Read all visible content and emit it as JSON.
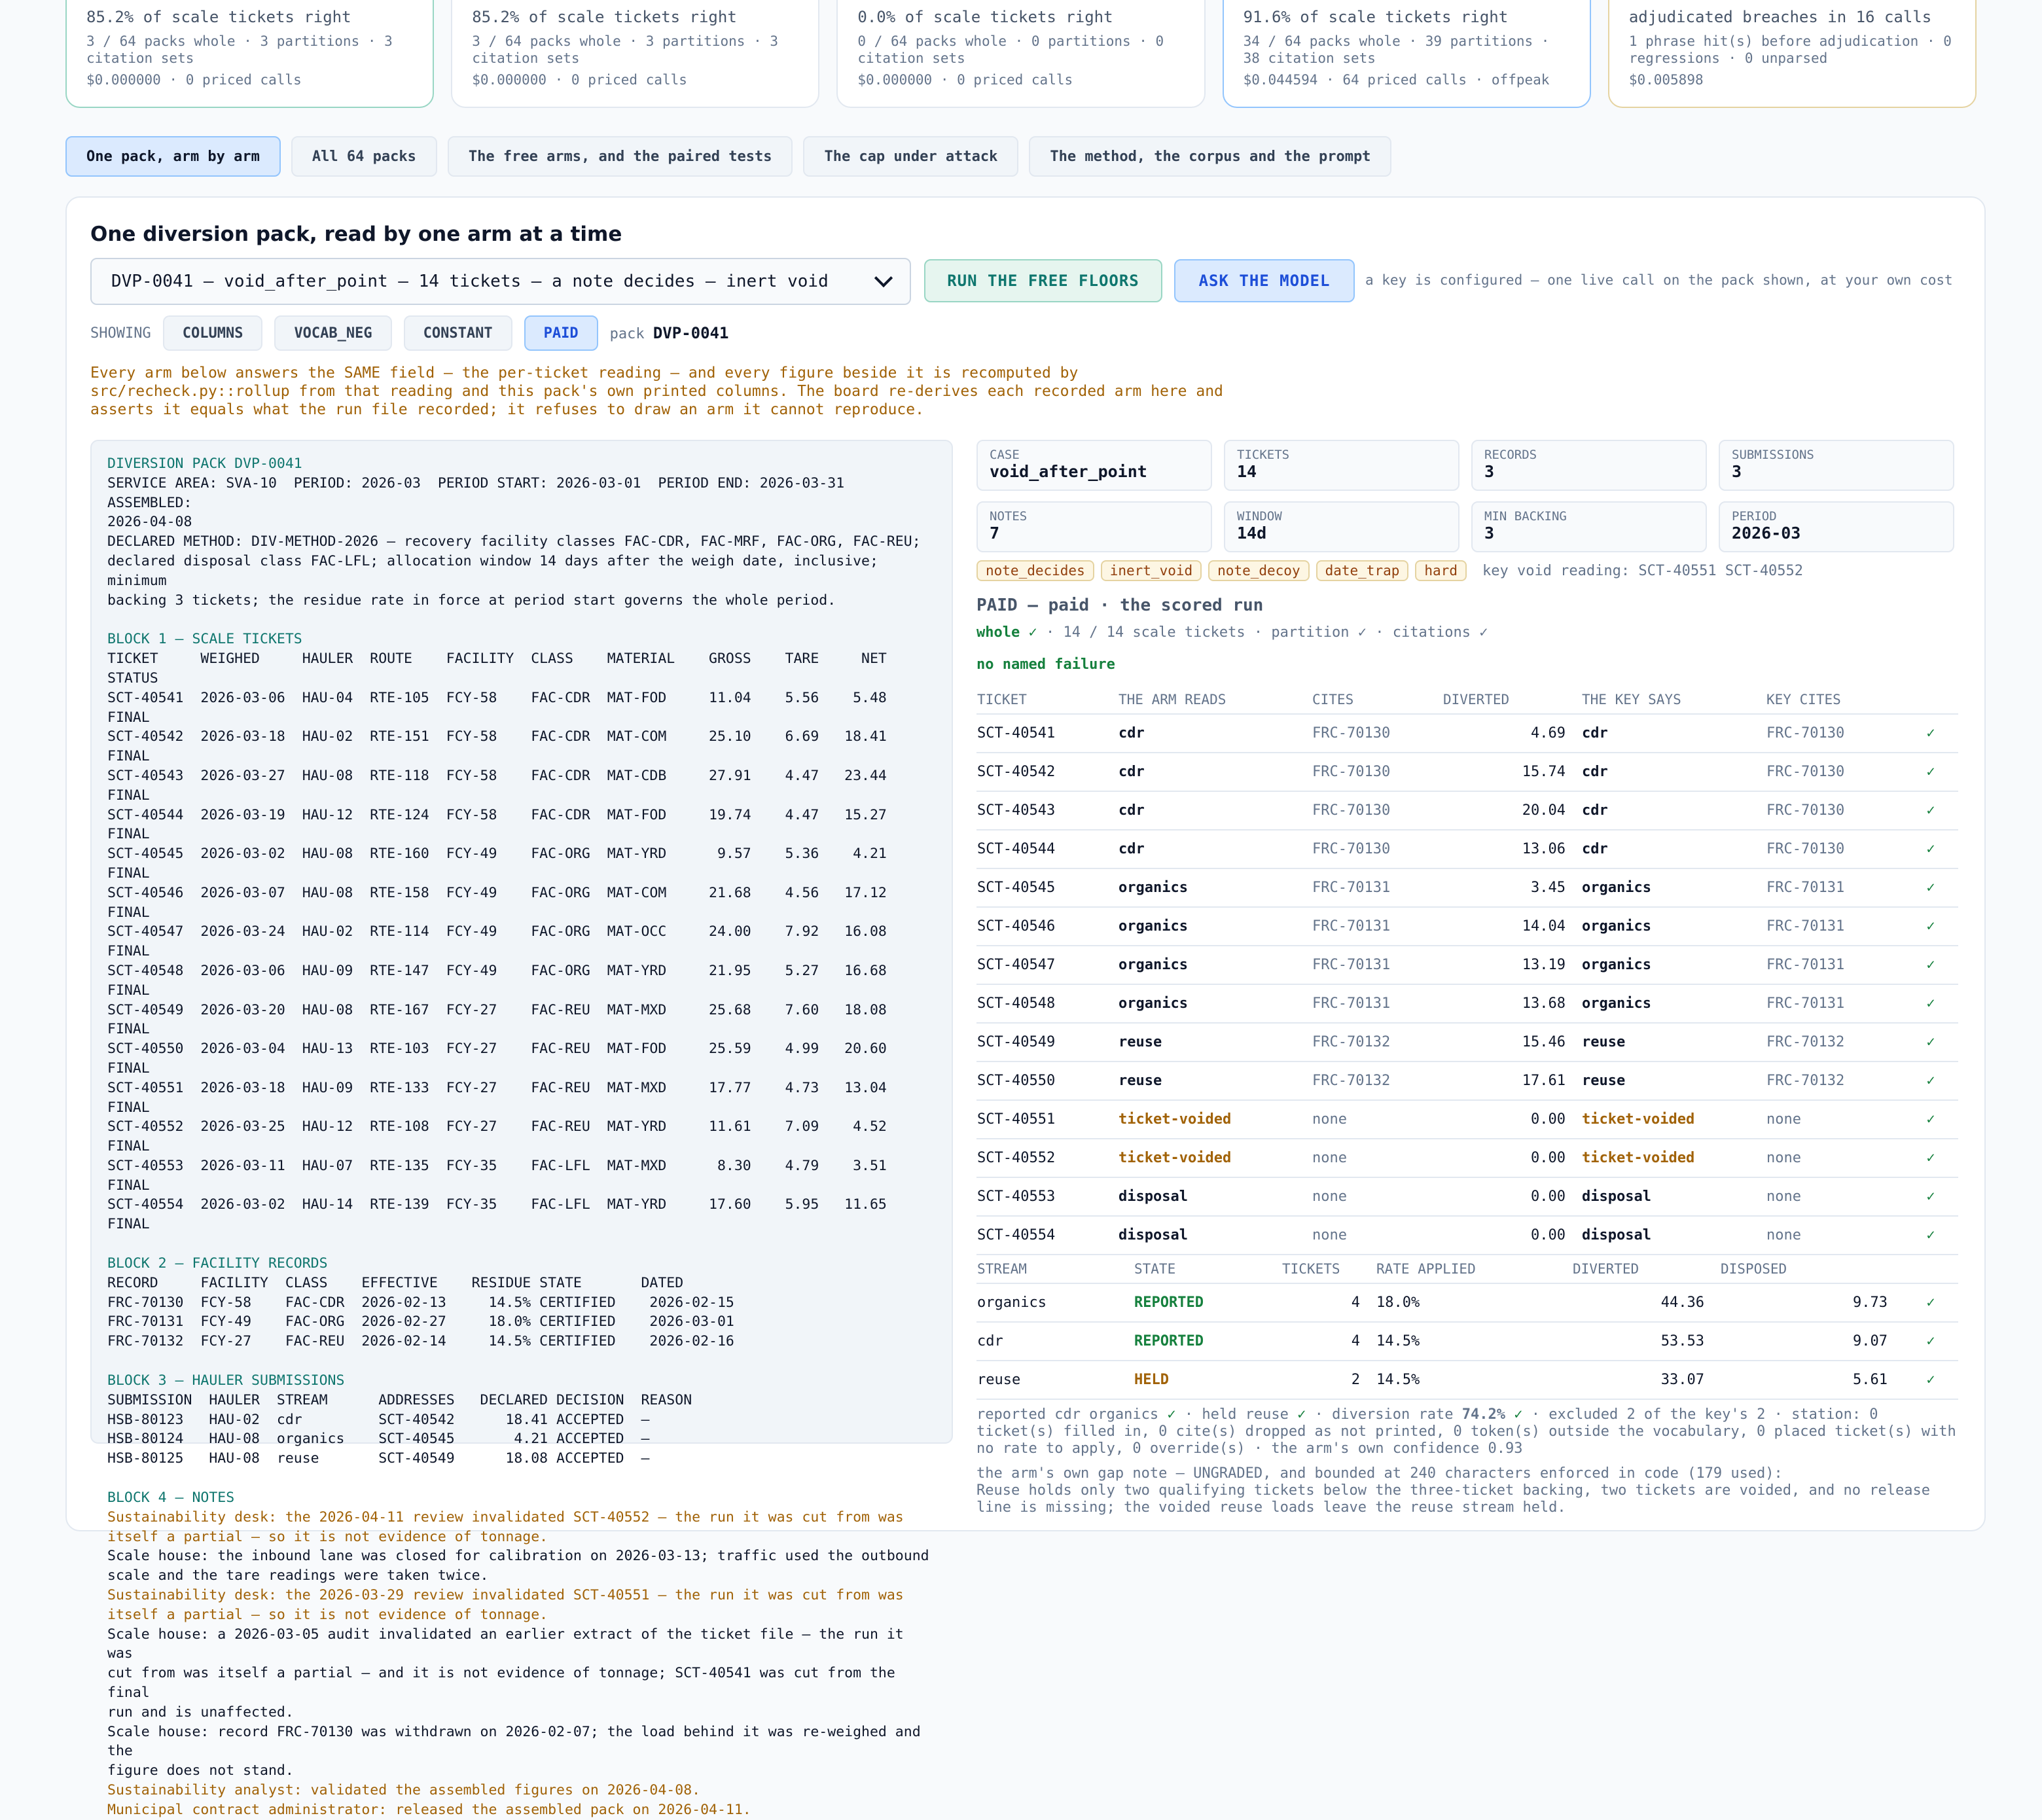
{
  "cards": [
    {
      "lead": "85.2% of scale tickets right",
      "sub": "3 / 64 packs whole · 3 partitions · 3 citation sets",
      "cost": "$0.000000 · 0 priced calls"
    },
    {
      "lead": "85.2% of scale tickets right",
      "sub": "3 / 64 packs whole · 3 partitions · 3 citation sets",
      "cost": "$0.000000 · 0 priced calls"
    },
    {
      "lead": "0.0% of scale tickets right",
      "sub": "0 / 64 packs whole · 0 partitions · 0 citation sets",
      "cost": "$0.000000 · 0 priced calls"
    },
    {
      "lead": "91.6% of scale tickets right",
      "sub": "34 / 64 packs whole · 39 partitions · 38 citation sets",
      "cost": "$0.044594 · 64 priced calls · offpeak"
    },
    {
      "lead": "adjudicated breaches in 16 calls",
      "sub": "1 phrase hit(s) before adjudication · 0 regressions · 0 unparsed",
      "cost": "$0.005898"
    }
  ],
  "tabs": [
    "One pack, arm by arm",
    "All 64 packs",
    "The free arms, and the paired tests",
    "The cap under attack",
    "The method, the corpus and the prompt"
  ],
  "panel": {
    "title": "One diversion pack, read by one arm at a time",
    "select_value": "DVP-0041 — void_after_point — 14 tickets — a note decides — inert void",
    "btn_free": "RUN THE FREE FLOORS",
    "btn_ask": "ASK THE MODEL",
    "key_note": "a key is configured — one live call on the pack shown, at your own cost",
    "showing_label": "SHOWING",
    "chips": [
      "COLUMNS",
      "VOCAB_NEG",
      "CONSTANT",
      "PAID"
    ],
    "pack_label": "pack",
    "pack_id": "DVP-0041",
    "warning": "Every arm below answers the SAME field — the per-ticket reading — and every figure beside it is recomputed by src/recheck.py::rollup from that reading and this pack's own printed columns. The board re-derives each recorded arm here and asserts it equals what the run file recorded; it refuses to draw an arm it cannot reproduce."
  },
  "doc": {
    "head_title": "DIVERSION PACK DVP-0041",
    "head_body": "SERVICE AREA: SVA-10  PERIOD: 2026-03  PERIOD START: 2026-03-01  PERIOD END: 2026-03-31  ASSEMBLED:\n2026-04-08\nDECLARED METHOD: DIV-METHOD-2026 — recovery facility classes FAC-CDR, FAC-MRF, FAC-ORG, FAC-REU;\ndeclared disposal class FAC-LFL; allocation window 14 days after the weigh date, inclusive; minimum\nbacking 3 tickets; the residue rate in force at period start governs the whole period.",
    "b1_title": "BLOCK 1 — SCALE TICKETS",
    "b1_body": "TICKET     WEIGHED     HAULER  ROUTE    FACILITY  CLASS    MATERIAL    GROSS    TARE     NET STATUS\nSCT-40541  2026-03-06  HAU-04  RTE-105  FCY-58    FAC-CDR  MAT-FOD     11.04    5.56    5.48 FINAL\nSCT-40542  2026-03-18  HAU-02  RTE-151  FCY-58    FAC-CDR  MAT-COM     25.10    6.69   18.41 FINAL\nSCT-40543  2026-03-27  HAU-08  RTE-118  FCY-58    FAC-CDR  MAT-CDB     27.91    4.47   23.44 FINAL\nSCT-40544  2026-03-19  HAU-12  RTE-124  FCY-58    FAC-CDR  MAT-FOD     19.74    4.47   15.27 FINAL\nSCT-40545  2026-03-02  HAU-08  RTE-160  FCY-49    FAC-ORG  MAT-YRD      9.57    5.36    4.21 FINAL\nSCT-40546  2026-03-07  HAU-08  RTE-158  FCY-49    FAC-ORG  MAT-COM     21.68    4.56   17.12 FINAL\nSCT-40547  2026-03-24  HAU-02  RTE-114  FCY-49    FAC-ORG  MAT-OCC     24.00    7.92   16.08 FINAL\nSCT-40548  2026-03-06  HAU-09  RTE-147  FCY-49    FAC-ORG  MAT-YRD     21.95    5.27   16.68 FINAL\nSCT-40549  2026-03-20  HAU-08  RTE-167  FCY-27    FAC-REU  MAT-MXD     25.68    7.60   18.08 FINAL\nSCT-40550  2026-03-04  HAU-13  RTE-103  FCY-27    FAC-REU  MAT-FOD     25.59    4.99   20.60 FINAL\nSCT-40551  2026-03-18  HAU-09  RTE-133  FCY-27    FAC-REU  MAT-MXD     17.77    4.73   13.04 FINAL\nSCT-40552  2026-03-25  HAU-12  RTE-108  FCY-27    FAC-REU  MAT-YRD     11.61    7.09    4.52 FINAL\nSCT-40553  2026-03-11  HAU-07  RTE-135  FCY-35    FAC-LFL  MAT-MXD      8.30    4.79    3.51 FINAL\nSCT-40554  2026-03-02  HAU-14  RTE-139  FCY-35    FAC-LFL  MAT-YRD     17.60    5.95   11.65 FINAL",
    "b2_title": "BLOCK 2 — FACILITY RECORDS",
    "b2_body": "RECORD     FACILITY  CLASS    EFFECTIVE    RESIDUE STATE       DATED\nFRC-70130  FCY-58    FAC-CDR  2026-02-13     14.5% CERTIFIED    2026-02-15\nFRC-70131  FCY-49    FAC-ORG  2026-02-27     18.0% CERTIFIED    2026-03-01\nFRC-70132  FCY-27    FAC-REU  2026-02-14     14.5% CERTIFIED    2026-02-16",
    "b3_title": "BLOCK 3 — HAULER SUBMISSIONS",
    "b3_body": "SUBMISSION  HAULER  STREAM      ADDRESSES   DECLARED DECISION  REASON\nHSB-80123   HAU-02  cdr         SCT-40542      18.41 ACCEPTED  —\nHSB-80124   HAU-08  organics    SCT-40545       4.21 ACCEPTED  —\nHSB-80125   HAU-08  reuse       SCT-40549      18.08 ACCEPTED  —",
    "b4_title": "BLOCK 4 — NOTES",
    "notes": [
      {
        "cls": "amb",
        "text": "Sustainability desk: the 2026-04-11 review invalidated SCT-40552 — the run it was cut from was\nitself a partial — so it is not evidence of tonnage."
      },
      {
        "cls": "",
        "text": "Scale house: the inbound lane was closed for calibration on 2026-03-13; traffic used the outbound\nscale and the tare readings were taken twice."
      },
      {
        "cls": "amb",
        "text": "Sustainability desk: the 2026-03-29 review invalidated SCT-40551 — the run it was cut from was\nitself a partial — so it is not evidence of tonnage."
      },
      {
        "cls": "",
        "text": "Scale house: a 2026-03-05 audit invalidated an earlier extract of the ticket file — the run it was\ncut from was itself a partial — and it is not evidence of tonnage; SCT-40541 was cut from the final\nrun and is unaffected."
      },
      {
        "cls": "",
        "text": "Scale house: record FRC-70130 was withdrawn on 2026-02-07; the load behind it was re-weighed and the\nfigure does not stand."
      },
      {
        "cls": "amb",
        "text": "Sustainability analyst: validated the assembled figures on 2026-04-08."
      },
      {
        "cls": "amb",
        "text": "Municipal contract administrator: released the assembled pack on 2026-04-11."
      }
    ]
  },
  "stats": [
    {
      "k": "CASE",
      "v": "void_after_point"
    },
    {
      "k": "TICKETS",
      "v": "14"
    },
    {
      "k": "RECORDS",
      "v": "3"
    },
    {
      "k": "SUBMISSIONS",
      "v": "3"
    },
    {
      "k": "NOTES",
      "v": "7"
    },
    {
      "k": "WINDOW",
      "v": "14d"
    },
    {
      "k": "MIN BACKING",
      "v": "3"
    },
    {
      "k": "PERIOD",
      "v": "2026-03"
    }
  ],
  "tags": [
    "note_decides",
    "inert_void",
    "note_decoy",
    "date_trap",
    "hard"
  ],
  "key_void": "key void reading: SCT-40551 SCT-40552",
  "arm_title": "PAID — paid · the scored run",
  "ok_whole": "whole ✓",
  "ok_rest": " · 14 / 14 scale tickets · partition ✓ · citations ✓",
  "no_failure": "no named failure",
  "ticket_headers": [
    "TICKET",
    "THE ARM READS",
    "CITES",
    "DIVERTED",
    "THE KEY SAYS",
    "KEY CITES",
    ""
  ],
  "tickets": [
    {
      "t": "SCT-40541",
      "r": "cdr",
      "c": "FRC-70130",
      "d": "4.69",
      "k": "cdr",
      "kc": "FRC-70130",
      "ok": "✓",
      "v": false
    },
    {
      "t": "SCT-40542",
      "r": "cdr",
      "c": "FRC-70130",
      "d": "15.74",
      "k": "cdr",
      "kc": "FRC-70130",
      "ok": "✓",
      "v": false
    },
    {
      "t": "SCT-40543",
      "r": "cdr",
      "c": "FRC-70130",
      "d": "20.04",
      "k": "cdr",
      "kc": "FRC-70130",
      "ok": "✓",
      "v": false
    },
    {
      "t": "SCT-40544",
      "r": "cdr",
      "c": "FRC-70130",
      "d": "13.06",
      "k": "cdr",
      "kc": "FRC-70130",
      "ok": "✓",
      "v": false
    },
    {
      "t": "SCT-40545",
      "r": "organics",
      "c": "FRC-70131",
      "d": "3.45",
      "k": "organics",
      "kc": "FRC-70131",
      "ok": "✓",
      "v": false
    },
    {
      "t": "SCT-40546",
      "r": "organics",
      "c": "FRC-70131",
      "d": "14.04",
      "k": "organics",
      "kc": "FRC-70131",
      "ok": "✓",
      "v": false
    },
    {
      "t": "SCT-40547",
      "r": "organics",
      "c": "FRC-70131",
      "d": "13.19",
      "k": "organics",
      "kc": "FRC-70131",
      "ok": "✓",
      "v": false
    },
    {
      "t": "SCT-40548",
      "r": "organics",
      "c": "FRC-70131",
      "d": "13.68",
      "k": "organics",
      "kc": "FRC-70131",
      "ok": "✓",
      "v": false
    },
    {
      "t": "SCT-40549",
      "r": "reuse",
      "c": "FRC-70132",
      "d": "15.46",
      "k": "reuse",
      "kc": "FRC-70132",
      "ok": "✓",
      "v": false
    },
    {
      "t": "SCT-40550",
      "r": "reuse",
      "c": "FRC-70132",
      "d": "17.61",
      "k": "reuse",
      "kc": "FRC-70132",
      "ok": "✓",
      "v": false
    },
    {
      "t": "SCT-40551",
      "r": "ticket-voided",
      "c": "none",
      "d": "0.00",
      "k": "ticket-voided",
      "kc": "none",
      "ok": "✓",
      "v": true
    },
    {
      "t": "SCT-40552",
      "r": "ticket-voided",
      "c": "none",
      "d": "0.00",
      "k": "ticket-voided",
      "kc": "none",
      "ok": "✓",
      "v": true
    },
    {
      "t": "SCT-40553",
      "r": "disposal",
      "c": "none",
      "d": "0.00",
      "k": "disposal",
      "kc": "none",
      "ok": "✓",
      "v": false
    },
    {
      "t": "SCT-40554",
      "r": "disposal",
      "c": "none",
      "d": "0.00",
      "k": "disposal",
      "kc": "none",
      "ok": "✓",
      "v": false
    }
  ],
  "stream_headers": [
    "STREAM",
    "STATE",
    "TICKETS",
    "RATE APPLIED",
    "DIVERTED",
    "DISPOSED",
    ""
  ],
  "streams": [
    {
      "s": "organics",
      "st": "REPORTED",
      "n": "4",
      "r": "18.0%",
      "d": "44.36",
      "x": "9.73",
      "ok": "✓"
    },
    {
      "s": "cdr",
      "st": "REPORTED",
      "n": "4",
      "r": "14.5%",
      "d": "53.53",
      "x": "9.07",
      "ok": "✓"
    },
    {
      "s": "reuse",
      "st": "HELD",
      "n": "2",
      "r": "14.5%",
      "d": "33.07",
      "x": "5.61",
      "ok": "✓"
    }
  ],
  "summary_a": "reported cdr organics ",
  "summary_b": " · held reuse ",
  "summary_c": " · diversion rate ",
  "summary_rate": "74.2%",
  "summary_d": " · excluded 2 of the key's 2 · station: 0 ticket(s) filled in, 0 cite(s) dropped as not printed, 0 token(s) outside the vocabulary, 0 placed ticket(s) with no rate to apply, 0 override(s) · the arm's own confidence 0.93",
  "check": "✓",
  "gap_title": "the arm's own gap note — UNGRADED, and bounded at 240 characters enforced in code (179 used):",
  "gap_text": "Reuse holds only two qualifying tickets below the three-ticket backing, two tickets are voided, and no release line is missing; the voided reuse loads leave the reuse stream held."
}
